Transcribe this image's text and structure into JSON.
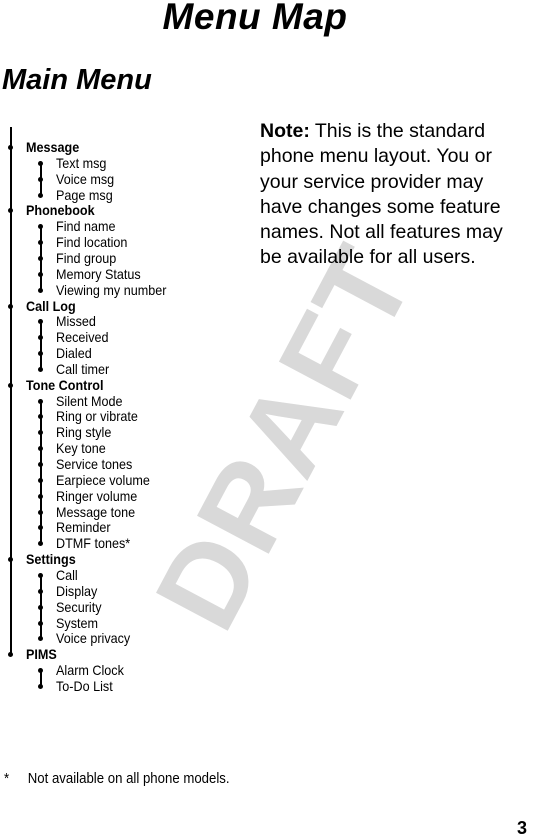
{
  "header": {
    "title": "Menu Map",
    "section_title": "Main Menu"
  },
  "watermark": "DRAFT",
  "menu": [
    {
      "label": "Message",
      "children": [
        "Text msg",
        "Voice msg",
        "Page msg"
      ]
    },
    {
      "label": "Phonebook",
      "children": [
        "Find name",
        "Find location",
        "Find group",
        "Memory Status",
        "Viewing my number"
      ]
    },
    {
      "label": "Call Log",
      "children": [
        "Missed",
        "Received",
        "Dialed",
        "Call timer"
      ]
    },
    {
      "label": "Tone Control",
      "children": [
        "Silent Mode",
        "Ring or vibrate",
        "Ring style",
        "Key tone",
        "Service tones",
        "Earpiece volume",
        "Ringer volume",
        "Message tone",
        "Reminder",
        "DTMF tones*"
      ]
    },
    {
      "label": "Settings",
      "children": [
        "Call",
        "Display",
        "Security",
        "System",
        "Voice privacy"
      ]
    },
    {
      "label": "PIMS",
      "children": [
        "Alarm Clock",
        "To-Do List"
      ]
    }
  ],
  "note": {
    "label": "Note:",
    "text": " This is the standard phone menu layout. You or your service provider may have changes some feature names. Not all features may be available for all users."
  },
  "footnote": {
    "marker": "*",
    "text": "Not available on all phone models."
  },
  "page_number": "3"
}
